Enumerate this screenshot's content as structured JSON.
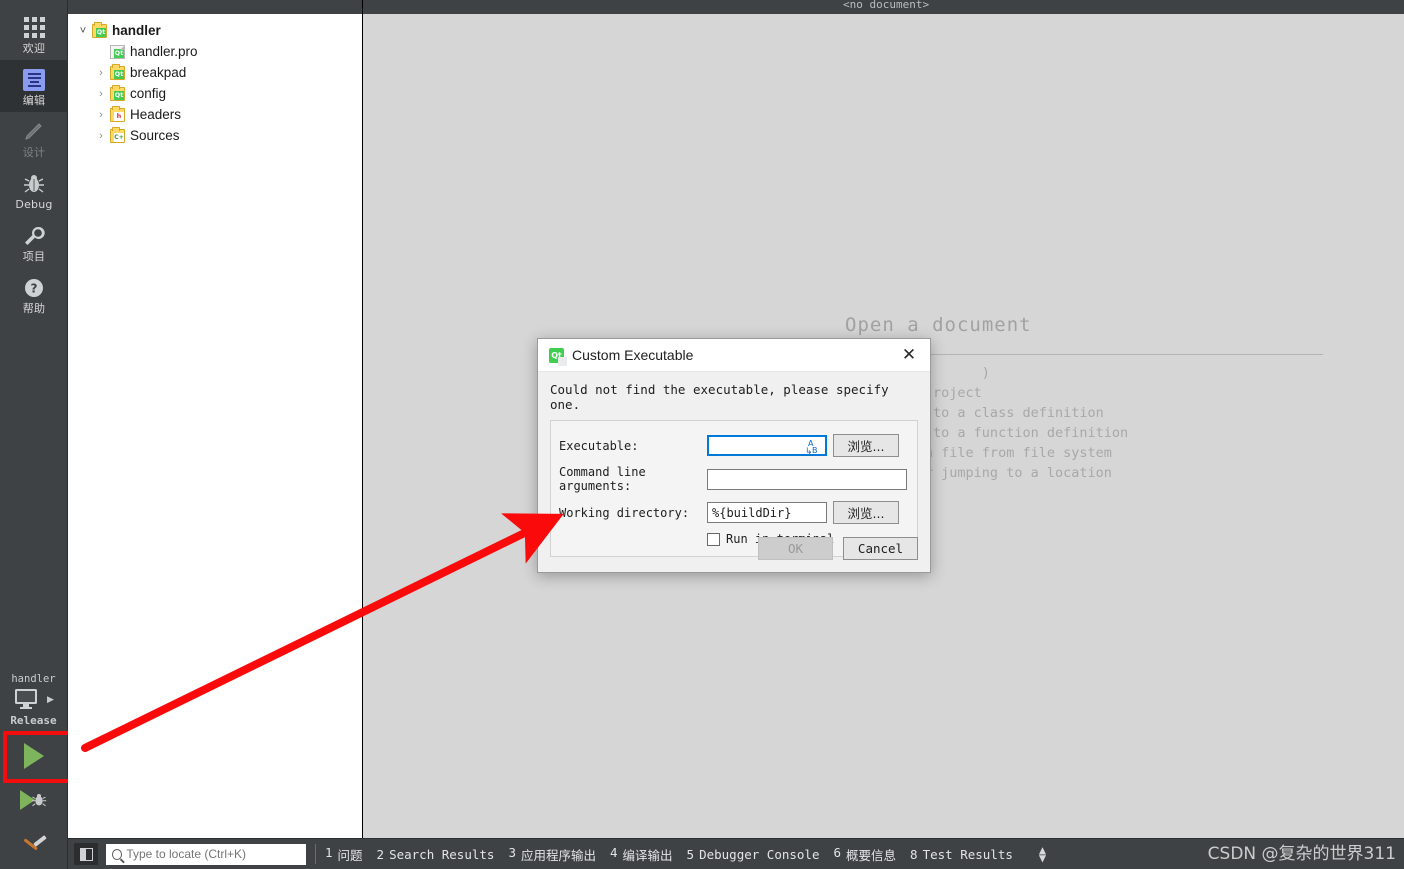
{
  "modebar": {
    "items": [
      {
        "label": "欢迎",
        "icon": "grid-icon",
        "state": "normal"
      },
      {
        "label": "编辑",
        "icon": "edit-icon",
        "state": "active"
      },
      {
        "label": "设计",
        "icon": "pencil-icon",
        "state": "disabled"
      },
      {
        "label": "Debug",
        "icon": "bug-icon",
        "state": "normal"
      },
      {
        "label": "项目",
        "icon": "wrench-icon",
        "state": "normal"
      },
      {
        "label": "帮助",
        "icon": "question-icon",
        "state": "normal"
      }
    ],
    "kit": {
      "project": "handler",
      "build_config": "Release"
    },
    "run_button": "run-icon",
    "debug_button": "debug-run-icon",
    "build_button": "build-hammer-icon"
  },
  "project_tree": {
    "nodes": [
      {
        "label": "handler",
        "icon": "qt-project-folder-icon",
        "expander": "open",
        "bold": true,
        "indent": 0
      },
      {
        "label": "handler.pro",
        "icon": "qt-pro-file-icon",
        "expander": "none",
        "bold": false,
        "indent": 1
      },
      {
        "label": "breakpad",
        "icon": "qt-project-folder-icon",
        "expander": "closed",
        "bold": false,
        "indent": 1
      },
      {
        "label": "config",
        "icon": "qt-project-folder-icon",
        "expander": "closed",
        "bold": false,
        "indent": 1
      },
      {
        "label": "Headers",
        "icon": "headers-folder-icon",
        "expander": "closed",
        "bold": false,
        "indent": 1
      },
      {
        "label": "Sources",
        "icon": "sources-folder-icon",
        "expander": "closed",
        "bold": false,
        "indent": 1
      }
    ]
  },
  "editor": {
    "document_label": "<no document>",
    "hint_title": "Open a document",
    "hint_lines": [
      "                      )",
      "",
      "                roject",
      "                to a class definition",
      "                to a function definition",
      "               n file from file system",
      "              or jumping to a location"
    ]
  },
  "dialog": {
    "icon": "qt-logo-icon",
    "title": "Custom Executable",
    "close_icon": "close-icon",
    "message": "Could not find the executable, please specify one.",
    "fields": [
      {
        "label": "Executable:",
        "value": "",
        "browse": "浏览...",
        "focused": true,
        "has_variable_icon": true
      },
      {
        "label": "Command line arguments:",
        "value": "",
        "browse": "",
        "focused": false,
        "has_variable_icon": false
      },
      {
        "label": "Working directory:",
        "value": "%{buildDir}",
        "browse": "浏览...",
        "focused": false,
        "has_variable_icon": false
      }
    ],
    "checkbox": {
      "label": "Run in terminal",
      "checked": false
    },
    "buttons": {
      "ok": "OK",
      "ok_disabled": true,
      "cancel": "Cancel"
    }
  },
  "statusbar": {
    "toggle_icon": "sidebar-toggle-icon",
    "locator_placeholder": "Type to locate (Ctrl+K)",
    "locator_value": "",
    "panes": [
      {
        "num": "1",
        "label": "问题"
      },
      {
        "num": "2",
        "label": "Search Results"
      },
      {
        "num": "3",
        "label": "应用程序输出"
      },
      {
        "num": "4",
        "label": "编译输出"
      },
      {
        "num": "5",
        "label": "Debugger Console"
      },
      {
        "num": "6",
        "label": "概要信息"
      },
      {
        "num": "8",
        "label": "Test Results"
      }
    ]
  },
  "watermark": {
    "text": "CSDN @复杂的世界311"
  },
  "annotations": {
    "highlight_color": "#f40d0d",
    "arrow_color": "#fa0a0a",
    "arrow_from": "run-button",
    "arrow_to": "custom-executable-dialog"
  }
}
